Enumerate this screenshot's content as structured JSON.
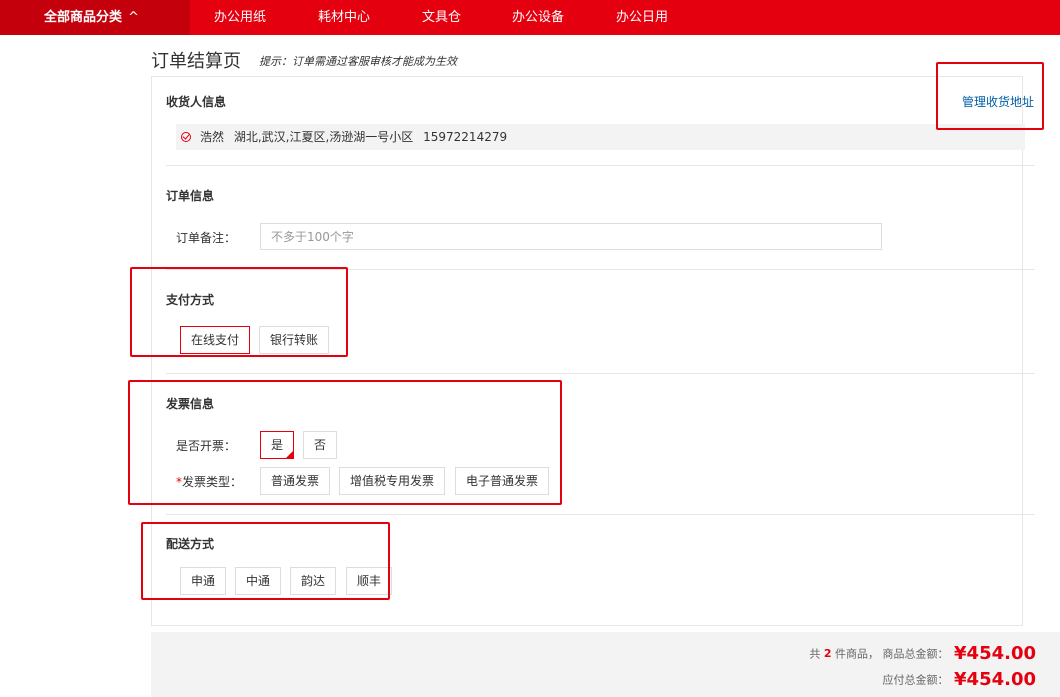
{
  "nav": {
    "all_categories": "全部商品分类",
    "items": [
      "办公用纸",
      "耗材中心",
      "文具仓",
      "办公设备",
      "办公日用"
    ]
  },
  "page": {
    "title": "订单结算页",
    "tip": "提示：订单需通过客服审核才能成为生效"
  },
  "consignee": {
    "title": "收货人信息",
    "manage_link": "管理收货地址",
    "name": "浩然",
    "address": "湖北,武汉,江夏区,汤逊湖一号小区",
    "phone": "15972214279"
  },
  "order_info": {
    "title": "订单信息",
    "note_label": "订单备注：",
    "note_placeholder": "不多于100个字",
    "note_value": ""
  },
  "payment": {
    "title": "支付方式",
    "options": [
      "在线支付",
      "银行转账"
    ],
    "selected": "在线支付"
  },
  "invoice": {
    "title": "发票信息",
    "need_label": "是否开票：",
    "need_options": [
      "是",
      "否"
    ],
    "need_selected": "是",
    "type_required_mark": "*",
    "type_label": "发票类型：",
    "type_options": [
      "普通发票",
      "增值税专用发票",
      "电子普通发票"
    ]
  },
  "delivery": {
    "title": "配送方式",
    "options": [
      "申通",
      "中通",
      "韵达",
      "顺丰"
    ]
  },
  "summary": {
    "count_prefix": "共",
    "count": "2",
    "count_suffix": "件商品，",
    "goods_total_label": "商品总金额：",
    "goods_total": "¥454.00",
    "payable_label": "应付总金额：",
    "payable_total": "¥454.00"
  },
  "colors": {
    "brand_red": "#e4000f",
    "link_blue": "#005ea7"
  }
}
